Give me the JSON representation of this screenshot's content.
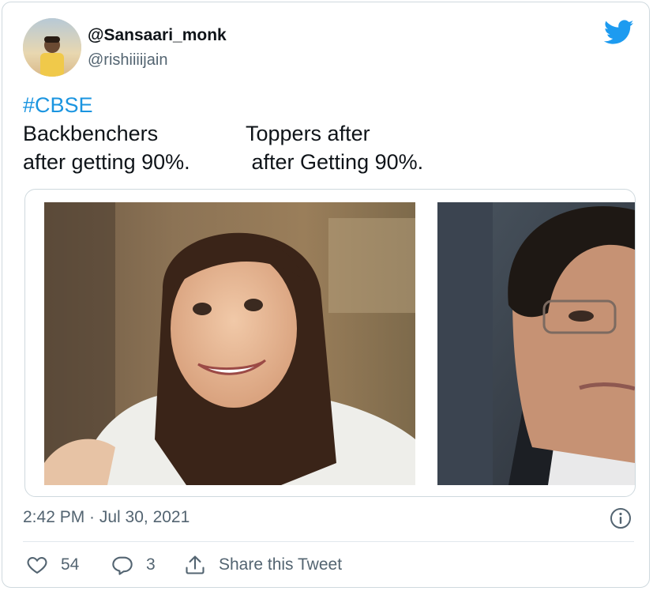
{
  "author": {
    "display_name": "@Sansaari_monk",
    "handle": "@rishiiiijain"
  },
  "tweet": {
    "hashtag": "#CBSE",
    "line1_left": "Backbenchers",
    "line1_right": "Toppers after",
    "line2_left": "after getting 90%.",
    "line2_right": " after Getting 90%."
  },
  "media": {
    "photo1_desc": "smiling-woman-photo",
    "photo2_desc": "man-with-glasses-photo"
  },
  "meta": {
    "timestamp": "2:42 PM · Jul 30, 2021"
  },
  "actions": {
    "likes": "54",
    "replies": "3",
    "share_label": "Share this Tweet"
  },
  "colors": {
    "brand": "#1d9bf0",
    "hashtag": "#1b95e0",
    "muted": "#536471",
    "border": "#cfd9de"
  }
}
